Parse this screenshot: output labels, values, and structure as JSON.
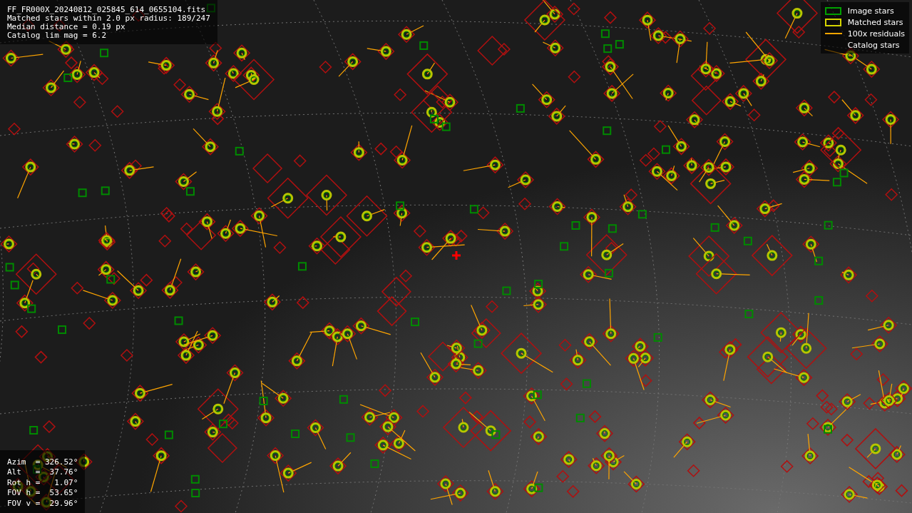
{
  "header": {
    "lines": [
      "FF_FR000X_20240812_025845_614_0655104.fits",
      "Matched stars within 2.0 px radius: 189/247",
      "Median distance = 0.19 px",
      "Catalog lim mag = 6.2"
    ]
  },
  "legend": [
    {
      "kind": "box",
      "color": "#00a000",
      "label": "Image stars"
    },
    {
      "kind": "box",
      "color": "#d4d400",
      "label": "Matched stars"
    },
    {
      "kind": "line",
      "color": "#ffa500",
      "label": "100x residuals"
    },
    {
      "kind": "none",
      "label": "Catalog stars"
    }
  ],
  "pointing": {
    "lines": [
      "Azim  = 326.52°",
      "Alt   =  37.76°",
      "Rot h =   1.07°",
      "FOV h =  53.65°",
      "FOV v =  29.96°"
    ]
  }
}
